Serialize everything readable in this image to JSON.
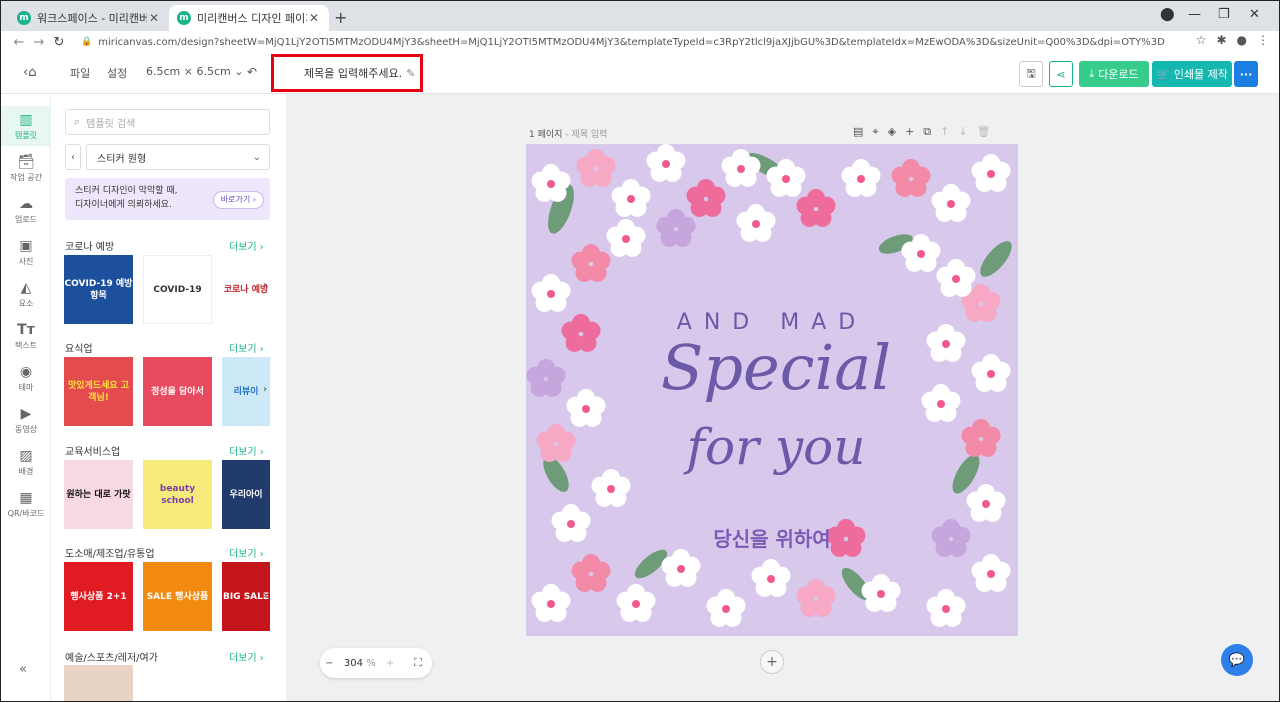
{
  "browser": {
    "tabs": [
      {
        "label": "워크스페이스 - 미리캔버스",
        "active": false
      },
      {
        "label": "미리캔버스 디자인 페이지",
        "active": true
      }
    ],
    "url": "miricanvas.com/design?sheetW=MjQ1LjY2OTI5MTMzODU4MjY3&sheetH=MjQ1LjY2OTI5MTMzODU4MjY3&templateTypeId=c3RpY2tlcl9jaXJjbGU%3D&templateIdx=MzEwODA%3D&sizeUnit=Q00%3D&dpi=OTY%3D"
  },
  "toolbar": {
    "file": "파일",
    "settings": "설정",
    "size": "6.5cm × 6.5cm",
    "title_placeholder": "제목을 입력해주세요.",
    "download": "다운로드",
    "print": "인쇄물 제작"
  },
  "rail": {
    "items": [
      {
        "label": "템플릿",
        "icon": "template-icon"
      },
      {
        "label": "작업 공간",
        "icon": "workspace-icon"
      },
      {
        "label": "업로드",
        "icon": "upload-icon"
      },
      {
        "label": "사진",
        "icon": "photo-icon"
      },
      {
        "label": "요소",
        "icon": "elements-icon"
      },
      {
        "label": "텍스트",
        "icon": "text-icon"
      },
      {
        "label": "테마",
        "icon": "theme-icon"
      },
      {
        "label": "동영상",
        "icon": "video-icon"
      },
      {
        "label": "배경",
        "icon": "background-icon"
      },
      {
        "label": "QR/바코드",
        "icon": "qr-icon"
      }
    ]
  },
  "panel": {
    "search_placeholder": "템플릿 검색",
    "category": "스티커 원형",
    "promo_line1": "스티커 디자인이 막막할 때,",
    "promo_line2": "디자이너에게 의뢰하세요.",
    "promo_button": "바로가기",
    "more_label": "더보기",
    "sections": [
      {
        "title": "코로나 예방",
        "thumbs": [
          "COVID-19 예방항목",
          "COVID-19",
          "코로나 예방"
        ]
      },
      {
        "title": "요식업",
        "thumbs": [
          "맛있게드세요 고객님!",
          "정성을 담아서",
          "리뷰이"
        ]
      },
      {
        "title": "교육서비스업",
        "thumbs": [
          "원하는 대로 가랏",
          "beauty school",
          "우리아이"
        ]
      },
      {
        "title": "도소매/제조업/유통업",
        "thumbs": [
          "행사상품 2+1",
          "SALE 행사상품",
          "BIG SALE"
        ]
      },
      {
        "title": "예술/스포츠/레저/여가",
        "thumbs": [
          "",
          "",
          ""
        ]
      }
    ]
  },
  "workspace": {
    "page_label": "1 페이지",
    "page_sub": "제목 입력",
    "zoom": "304",
    "zoom_unit": "%"
  },
  "design": {
    "arc_text": "AND MAD",
    "headline1": "Special",
    "headline2": "for you",
    "korean": "당신을 위하여"
  },
  "colors": {
    "accent": "#1cb38a",
    "download": "#36cc8c",
    "print": "#14b8b0",
    "more": "#1a7fe0",
    "highlight": "#e60012",
    "canvas_bg": "#d8c8ec",
    "script_text": "#6a5aa8"
  }
}
